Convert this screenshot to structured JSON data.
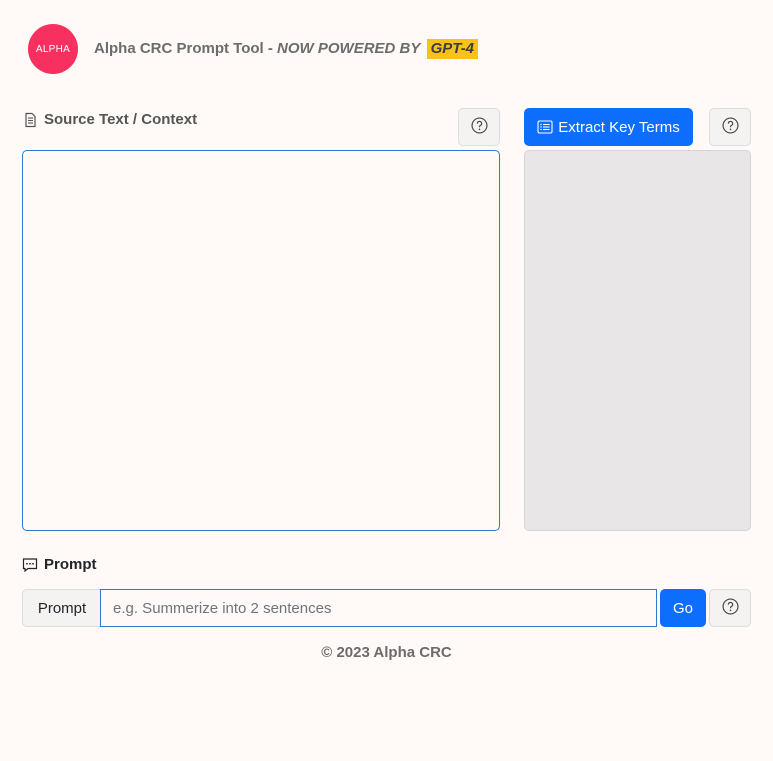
{
  "header": {
    "logo_text": "ALPHA",
    "title": "Alpha CRC Prompt Tool - ",
    "powered_by": "NOW POWERED BY",
    "badge": "GPT-4"
  },
  "source": {
    "label": "Source Text / Context",
    "label_icon": "document-icon",
    "help_icon": "question-circle-icon",
    "value": ""
  },
  "key_terms": {
    "button_label": "Extract Key Terms",
    "button_icon": "list-icon",
    "help_icon": "question-circle-icon"
  },
  "prompt": {
    "section_label": "Prompt",
    "section_icon": "chat-dots-icon",
    "group_label": "Prompt",
    "placeholder": "e.g. Summerize into 2 sentences",
    "value": "",
    "go_label": "Go",
    "help_icon": "question-circle-icon"
  },
  "footer": {
    "text": "© 2023 Alpha CRC"
  },
  "colors": {
    "brand": "#f7305f",
    "primary": "#0d6efd",
    "badge": "#f8c218",
    "background": "#fff9f7"
  }
}
